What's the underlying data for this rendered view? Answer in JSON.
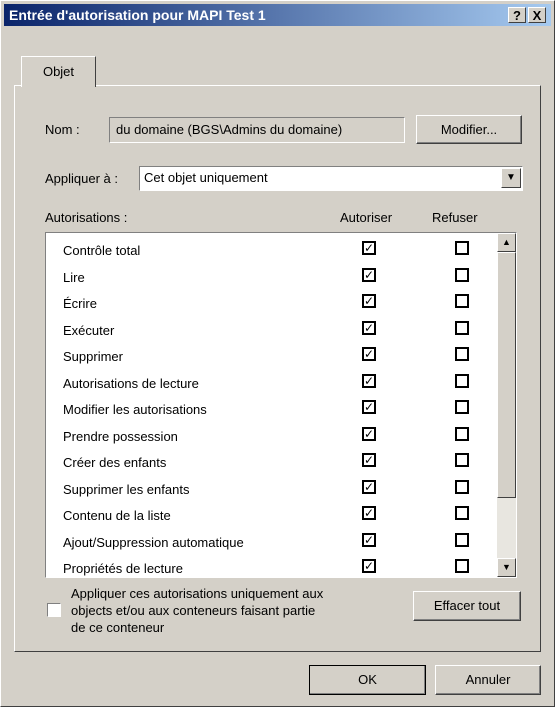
{
  "window": {
    "title": "Entrée d'autorisation pour MAPI Test 1",
    "help_btn": "?",
    "close_btn": "X"
  },
  "tab": {
    "label": "Objet"
  },
  "name": {
    "label": "Nom :",
    "value": "du domaine (BGS\\Admins du domaine)",
    "modify_button": "Modifier..."
  },
  "apply_to": {
    "label": "Appliquer à :",
    "value": "Cet objet uniquement"
  },
  "permissions": {
    "label": "Autorisations :",
    "col_allow": "Autoriser",
    "col_deny": "Refuser",
    "items": [
      {
        "name": "Contrôle total",
        "allow": true,
        "deny": false
      },
      {
        "name": "Lire",
        "allow": true,
        "deny": false
      },
      {
        "name": "Écrire",
        "allow": true,
        "deny": false
      },
      {
        "name": "Exécuter",
        "allow": true,
        "deny": false
      },
      {
        "name": "Supprimer",
        "allow": true,
        "deny": false
      },
      {
        "name": "Autorisations de lecture",
        "allow": true,
        "deny": false
      },
      {
        "name": "Modifier les autorisations",
        "allow": true,
        "deny": false
      },
      {
        "name": "Prendre possession",
        "allow": true,
        "deny": false
      },
      {
        "name": "Créer des enfants",
        "allow": true,
        "deny": false
      },
      {
        "name": "Supprimer les enfants",
        "allow": true,
        "deny": false
      },
      {
        "name": "Contenu de la liste",
        "allow": true,
        "deny": false
      },
      {
        "name": "Ajout/Suppression automatique",
        "allow": true,
        "deny": false
      },
      {
        "name": "Propriétés de lecture",
        "allow": true,
        "deny": false
      }
    ]
  },
  "apply_only": {
    "line1": "Appliquer ces autorisations uniquement aux",
    "line2": "objects et/ou aux conteneurs faisant partie",
    "line3": "de ce conteneur",
    "checked": false
  },
  "clear_all_button": "Effacer tout",
  "ok_button": "OK",
  "cancel_button": "Annuler"
}
